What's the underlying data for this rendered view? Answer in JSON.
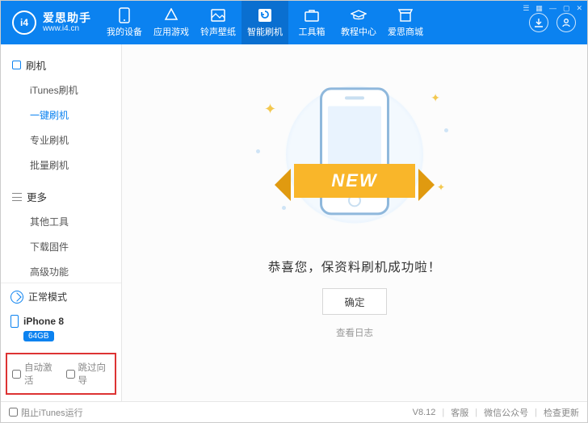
{
  "app": {
    "name": "爱思助手",
    "site": "www.i4.cn",
    "logo_letters": "i4"
  },
  "tabs": [
    {
      "id": "device",
      "label": "我的设备"
    },
    {
      "id": "games",
      "label": "应用游戏"
    },
    {
      "id": "ring",
      "label": "铃声壁纸"
    },
    {
      "id": "flash",
      "label": "智能刷机",
      "active": true
    },
    {
      "id": "toolbox",
      "label": "工具箱"
    },
    {
      "id": "tutorial",
      "label": "教程中心"
    },
    {
      "id": "mall",
      "label": "爱思商城"
    }
  ],
  "sidebar": {
    "groups": [
      {
        "title": "刷机",
        "icon": "square",
        "items": [
          {
            "label": "iTunes刷机"
          },
          {
            "label": "一键刷机",
            "active": true
          },
          {
            "label": "专业刷机"
          },
          {
            "label": "批量刷机"
          }
        ]
      },
      {
        "title": "更多",
        "icon": "bars",
        "items": [
          {
            "label": "其他工具"
          },
          {
            "label": "下载固件"
          },
          {
            "label": "高级功能"
          }
        ]
      }
    ],
    "mode_label": "正常模式",
    "device": {
      "name": "iPhone 8",
      "storage": "64GB"
    },
    "options": {
      "auto_activate": "自动激活",
      "skip_guide": "跳过向导"
    }
  },
  "main": {
    "ribbon": "NEW",
    "success": "恭喜您，保资料刷机成功啦！",
    "ok": "确定",
    "view_log": "查看日志"
  },
  "footer": {
    "block_itunes": "阻止iTunes运行",
    "version": "V8.12",
    "support": "客服",
    "wechat": "微信公众号",
    "update": "检查更新"
  }
}
